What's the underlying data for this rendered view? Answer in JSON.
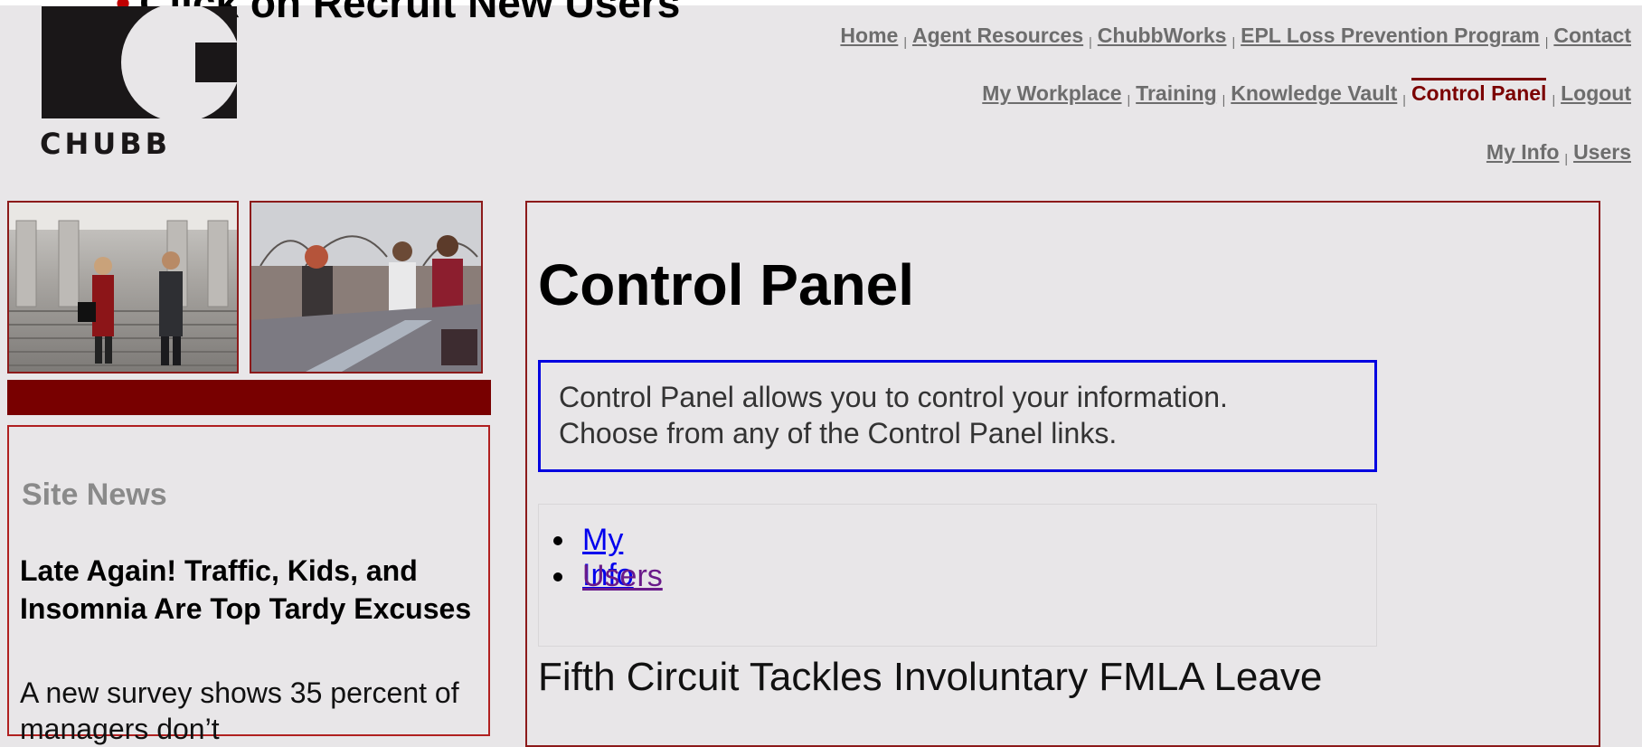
{
  "caption": {
    "bullet": "•",
    "text": "Click on Recruit New Users"
  },
  "logo": {
    "text": "CHUBB"
  },
  "nav_primary": [
    "Home",
    "Agent Resources",
    "ChubbWorks",
    "EPL Loss Prevention Program",
    "Contact"
  ],
  "nav_secondary": [
    "My Workplace",
    "Training",
    "Knowledge Vault",
    "Control Panel",
    "Logout"
  ],
  "nav_secondary_active": "Control Panel",
  "nav_tertiary": [
    "My Info",
    "Users"
  ],
  "nav_separator": "|",
  "colors": {
    "accent_red": "#780000",
    "link_blue": "#0000ee",
    "link_visited": "#6a1a8a",
    "nav_gray": "#6d6d6d"
  },
  "sidebar": {
    "news_title": "Site News",
    "headline": "Late Again! Traffic, Kids, and Insomnia Are Top Tardy Excuses",
    "body": "A new survey shows 35 percent of managers don’t"
  },
  "main": {
    "title": "Control Panel",
    "info_line1": "Control Panel allows you to control your information.",
    "info_line2": "Choose from any of the Control Panel links.",
    "links": [
      "My Info",
      "Users"
    ],
    "article_title": "Fifth Circuit Tackles Involuntary FMLA Leave"
  }
}
